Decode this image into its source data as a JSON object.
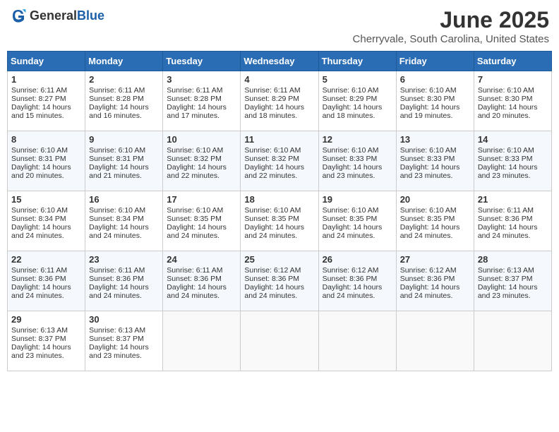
{
  "header": {
    "logo_general": "General",
    "logo_blue": "Blue",
    "title": "June 2025",
    "subtitle": "Cherryvale, South Carolina, United States"
  },
  "calendar": {
    "days_of_week": [
      "Sunday",
      "Monday",
      "Tuesday",
      "Wednesday",
      "Thursday",
      "Friday",
      "Saturday"
    ],
    "weeks": [
      [
        {
          "day": "1",
          "sunrise": "6:11 AM",
          "sunset": "8:27 PM",
          "daylight": "14 hours and 15 minutes."
        },
        {
          "day": "2",
          "sunrise": "6:11 AM",
          "sunset": "8:28 PM",
          "daylight": "14 hours and 16 minutes."
        },
        {
          "day": "3",
          "sunrise": "6:11 AM",
          "sunset": "8:28 PM",
          "daylight": "14 hours and 17 minutes."
        },
        {
          "day": "4",
          "sunrise": "6:11 AM",
          "sunset": "8:29 PM",
          "daylight": "14 hours and 18 minutes."
        },
        {
          "day": "5",
          "sunrise": "6:10 AM",
          "sunset": "8:29 PM",
          "daylight": "14 hours and 18 minutes."
        },
        {
          "day": "6",
          "sunrise": "6:10 AM",
          "sunset": "8:30 PM",
          "daylight": "14 hours and 19 minutes."
        },
        {
          "day": "7",
          "sunrise": "6:10 AM",
          "sunset": "8:30 PM",
          "daylight": "14 hours and 20 minutes."
        }
      ],
      [
        {
          "day": "8",
          "sunrise": "6:10 AM",
          "sunset": "8:31 PM",
          "daylight": "14 hours and 20 minutes."
        },
        {
          "day": "9",
          "sunrise": "6:10 AM",
          "sunset": "8:31 PM",
          "daylight": "14 hours and 21 minutes."
        },
        {
          "day": "10",
          "sunrise": "6:10 AM",
          "sunset": "8:32 PM",
          "daylight": "14 hours and 22 minutes."
        },
        {
          "day": "11",
          "sunrise": "6:10 AM",
          "sunset": "8:32 PM",
          "daylight": "14 hours and 22 minutes."
        },
        {
          "day": "12",
          "sunrise": "6:10 AM",
          "sunset": "8:33 PM",
          "daylight": "14 hours and 23 minutes."
        },
        {
          "day": "13",
          "sunrise": "6:10 AM",
          "sunset": "8:33 PM",
          "daylight": "14 hours and 23 minutes."
        },
        {
          "day": "14",
          "sunrise": "6:10 AM",
          "sunset": "8:33 PM",
          "daylight": "14 hours and 23 minutes."
        }
      ],
      [
        {
          "day": "15",
          "sunrise": "6:10 AM",
          "sunset": "8:34 PM",
          "daylight": "14 hours and 24 minutes."
        },
        {
          "day": "16",
          "sunrise": "6:10 AM",
          "sunset": "8:34 PM",
          "daylight": "14 hours and 24 minutes."
        },
        {
          "day": "17",
          "sunrise": "6:10 AM",
          "sunset": "8:35 PM",
          "daylight": "14 hours and 24 minutes."
        },
        {
          "day": "18",
          "sunrise": "6:10 AM",
          "sunset": "8:35 PM",
          "daylight": "14 hours and 24 minutes."
        },
        {
          "day": "19",
          "sunrise": "6:10 AM",
          "sunset": "8:35 PM",
          "daylight": "14 hours and 24 minutes."
        },
        {
          "day": "20",
          "sunrise": "6:10 AM",
          "sunset": "8:35 PM",
          "daylight": "14 hours and 24 minutes."
        },
        {
          "day": "21",
          "sunrise": "6:11 AM",
          "sunset": "8:36 PM",
          "daylight": "14 hours and 24 minutes."
        }
      ],
      [
        {
          "day": "22",
          "sunrise": "6:11 AM",
          "sunset": "8:36 PM",
          "daylight": "14 hours and 24 minutes."
        },
        {
          "day": "23",
          "sunrise": "6:11 AM",
          "sunset": "8:36 PM",
          "daylight": "14 hours and 24 minutes."
        },
        {
          "day": "24",
          "sunrise": "6:11 AM",
          "sunset": "8:36 PM",
          "daylight": "14 hours and 24 minutes."
        },
        {
          "day": "25",
          "sunrise": "6:12 AM",
          "sunset": "8:36 PM",
          "daylight": "14 hours and 24 minutes."
        },
        {
          "day": "26",
          "sunrise": "6:12 AM",
          "sunset": "8:36 PM",
          "daylight": "14 hours and 24 minutes."
        },
        {
          "day": "27",
          "sunrise": "6:12 AM",
          "sunset": "8:36 PM",
          "daylight": "14 hours and 24 minutes."
        },
        {
          "day": "28",
          "sunrise": "6:13 AM",
          "sunset": "8:37 PM",
          "daylight": "14 hours and 23 minutes."
        }
      ],
      [
        {
          "day": "29",
          "sunrise": "6:13 AM",
          "sunset": "8:37 PM",
          "daylight": "14 hours and 23 minutes."
        },
        {
          "day": "30",
          "sunrise": "6:13 AM",
          "sunset": "8:37 PM",
          "daylight": "14 hours and 23 minutes."
        },
        null,
        null,
        null,
        null,
        null
      ]
    ]
  }
}
